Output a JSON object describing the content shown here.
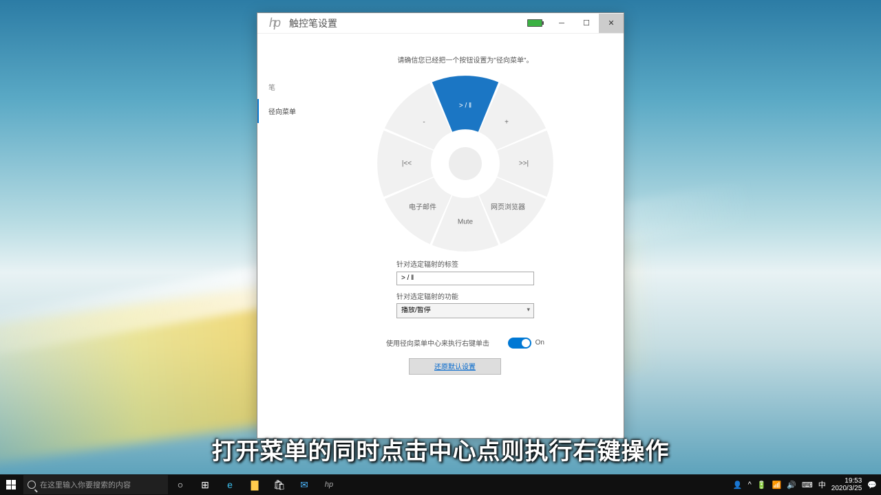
{
  "app": {
    "title": "触控笔设置",
    "battery_level": 100
  },
  "sidebar": {
    "items": [
      {
        "label": "笔",
        "active": false
      },
      {
        "label": "径向菜单",
        "active": true
      }
    ]
  },
  "main": {
    "instruction": "请确信您已经把一个按钮设置为\"径向菜单\"。",
    "radial_segments": [
      {
        "label": "> / ‖",
        "active": true
      },
      {
        "label": "+",
        "active": false
      },
      {
        "label": ">>|",
        "active": false
      },
      {
        "label": "网页浏览器",
        "active": false
      },
      {
        "label": "Mute",
        "active": false
      },
      {
        "label": "电子邮件",
        "active": false
      },
      {
        "label": "|<<",
        "active": false
      },
      {
        "label": "-",
        "active": false
      }
    ],
    "label_field_label": "针对选定辐射的标签",
    "label_field_value": "> / ‖",
    "func_field_label": "针对选定辐射的功能",
    "func_field_value": "播放/暂停",
    "toggle_label": "使用径向菜单中心来执行右键单击",
    "toggle_state": "On",
    "reset_button": "还原默认设置"
  },
  "subtitle": "打开菜单的同时点击中心点则执行右键操作",
  "taskbar": {
    "search_placeholder": "在这里输入你要搜索的内容",
    "ime": "中",
    "time": "19:53",
    "date": "2020/3/25"
  }
}
